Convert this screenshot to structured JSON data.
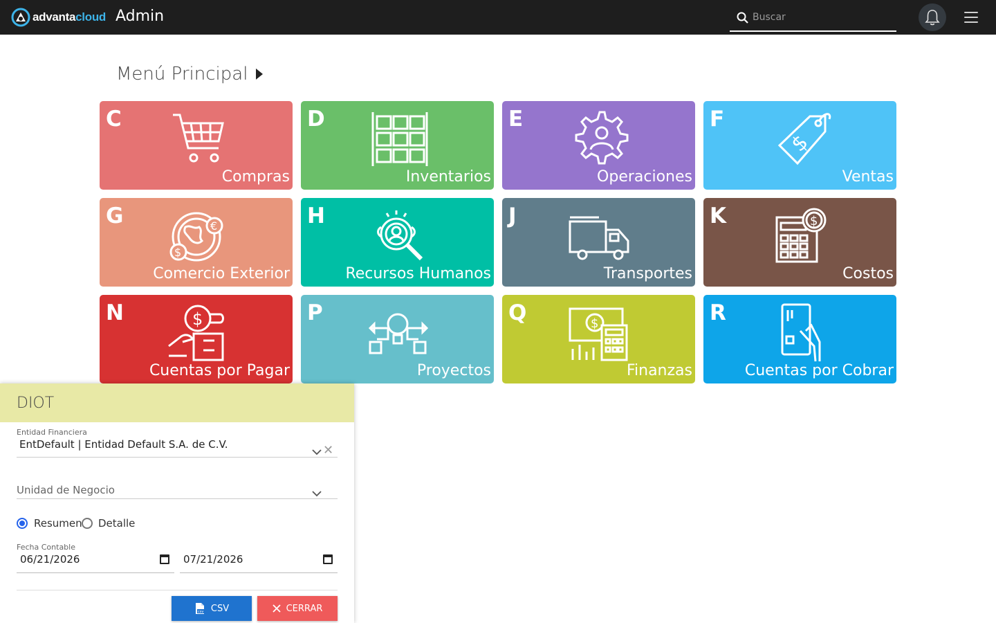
{
  "topbar": {
    "logo_part1": "advanta",
    "logo_part2": "cloud",
    "app_title": "Admin",
    "search_placeholder": "Buscar"
  },
  "section_title": "Menú Principal",
  "tiles": [
    {
      "letter": "C",
      "label": "Compras",
      "color": "#e57373",
      "icon": "shopping-cart-icon"
    },
    {
      "letter": "D",
      "label": "Inventarios",
      "color": "#6abf69",
      "icon": "boxes-shelf-icon"
    },
    {
      "letter": "E",
      "label": "Operaciones",
      "color": "#9575cd",
      "icon": "gear-person-icon"
    },
    {
      "letter": "F",
      "label": "Ventas",
      "color": "#4fc3f7",
      "icon": "price-tag-icon"
    },
    {
      "letter": "G",
      "label": "Comercio Exterior",
      "color": "#e8967c",
      "icon": "globe-currency-icon"
    },
    {
      "letter": "H",
      "label": "Recursos Humanos",
      "color": "#00bfa5",
      "icon": "search-person-icon"
    },
    {
      "letter": "J",
      "label": "Transportes",
      "color": "#607d8b",
      "icon": "truck-icon"
    },
    {
      "letter": "K",
      "label": "Costos",
      "color": "#795548",
      "icon": "calculator-coin-icon"
    },
    {
      "letter": "N",
      "label": "Cuentas por Pagar",
      "color": "#d73232",
      "icon": "hand-coin-icon"
    },
    {
      "letter": "P",
      "label": "Proyectos",
      "color": "#66bfcb",
      "icon": "lightbulb-project-icon"
    },
    {
      "letter": "Q",
      "label": "Finanzas",
      "color": "#c0ca33",
      "icon": "finance-calculator-icon"
    },
    {
      "letter": "R",
      "label": "Cuentas por Cobrar",
      "color": "#0ea5e9",
      "icon": "hand-card-icon"
    }
  ],
  "diot": {
    "title": "DIOT",
    "entidad_label": "Entidad Financiera",
    "entidad_value": "EntDefault | Entidad Default S.A. de C.V.",
    "unidad_placeholder": "Unidad de Negocio",
    "radio_resumen": "Resumen",
    "radio_detalle": "Detalle",
    "fecha_label": "Fecha Contable",
    "fecha_desde": "06/21/2026",
    "fecha_hasta": "07/21/2026",
    "csv_button": "CSV",
    "close_button": "CERRAR"
  }
}
